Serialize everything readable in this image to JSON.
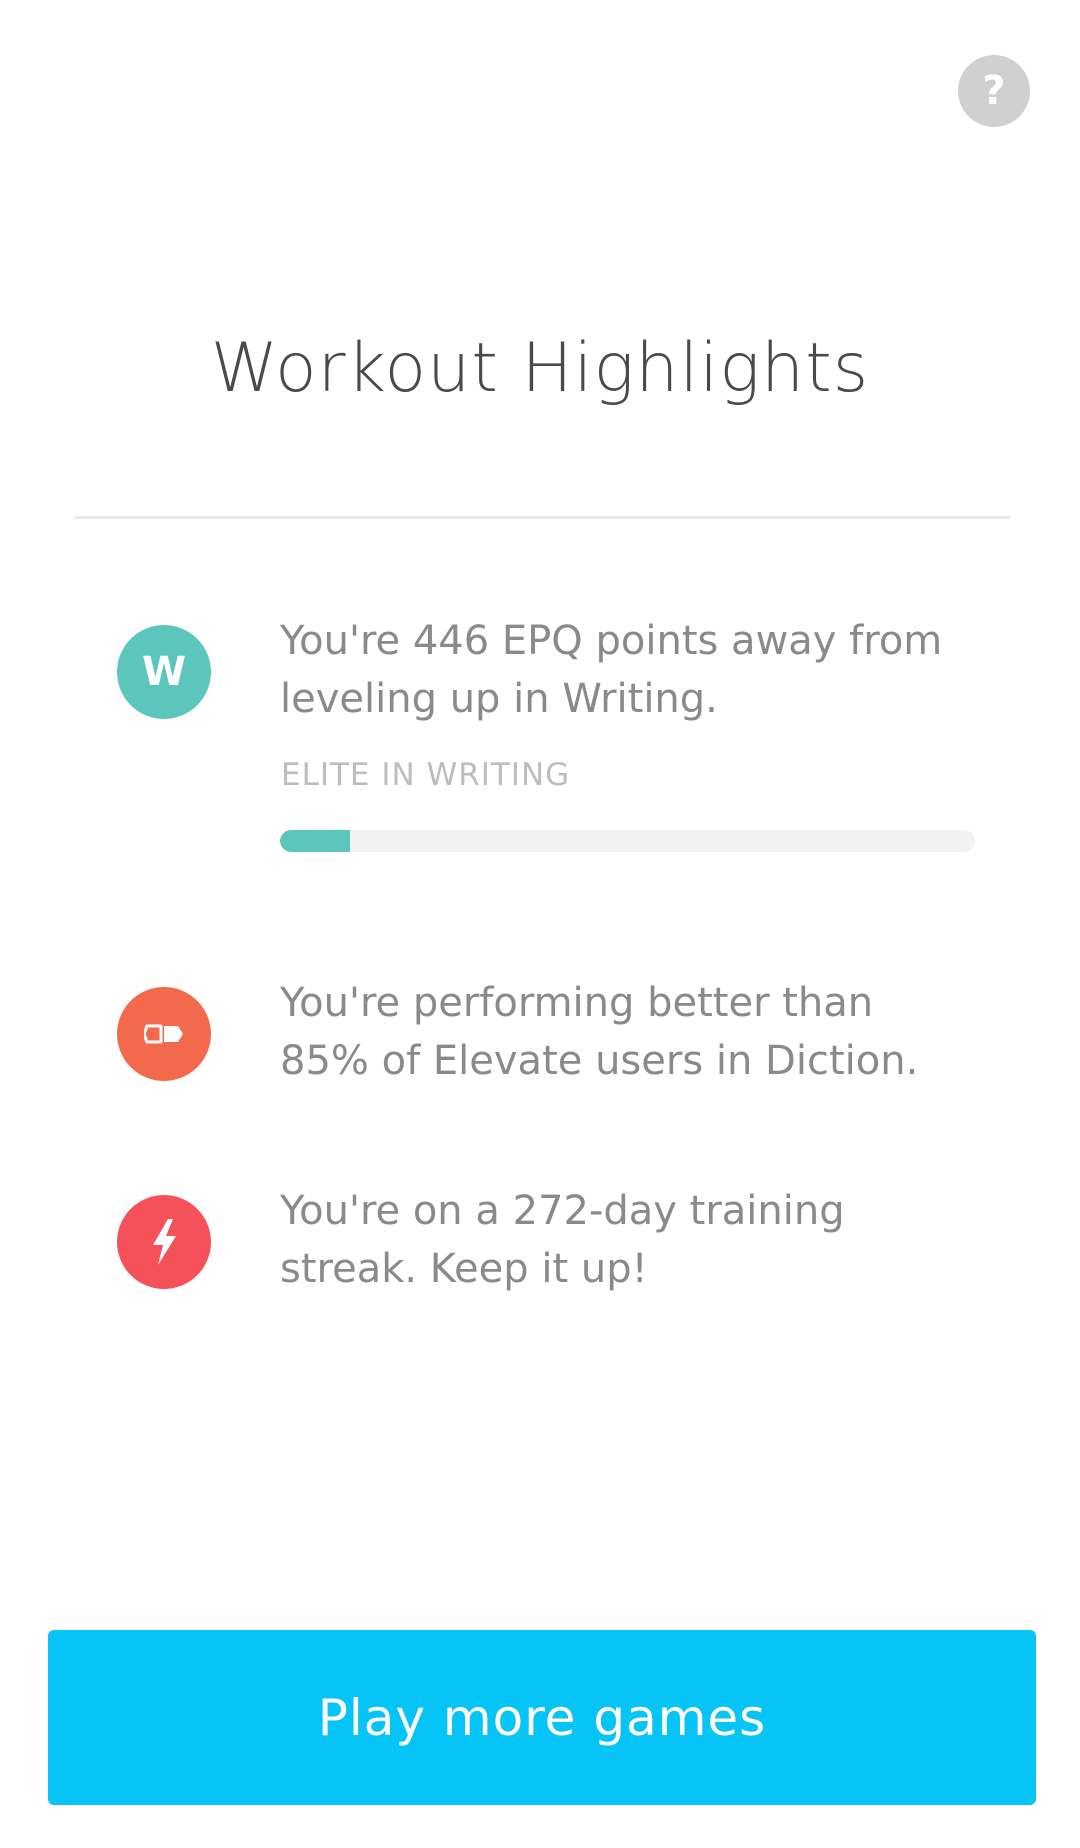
{
  "header": {
    "help_icon": "question-mark-icon",
    "help_glyph": "?"
  },
  "title": "Workout Highlights",
  "highlights": [
    {
      "icon": "writing-letter-icon",
      "icon_letter": "W",
      "icon_color": "#5cc6bc",
      "text": "You're 446 EPQ points away from\nleveling up in Writing.",
      "progress": {
        "label": "ELITE IN WRITING",
        "fraction": 0.1,
        "fill_color": "#5cc6bc",
        "track_color": "#f2f2f2"
      }
    },
    {
      "icon": "diction-tag-icon",
      "icon_color": "#f26a4b",
      "text": "You're performing better than\n85% of Elevate users in Diction."
    },
    {
      "icon": "lightning-bolt-icon",
      "icon_color": "#f5515a",
      "text": "You're on a 272-day training\nstreak. Keep it up!"
    }
  ],
  "primary_action": {
    "label": "Play more games",
    "color": "#06c4f5"
  }
}
